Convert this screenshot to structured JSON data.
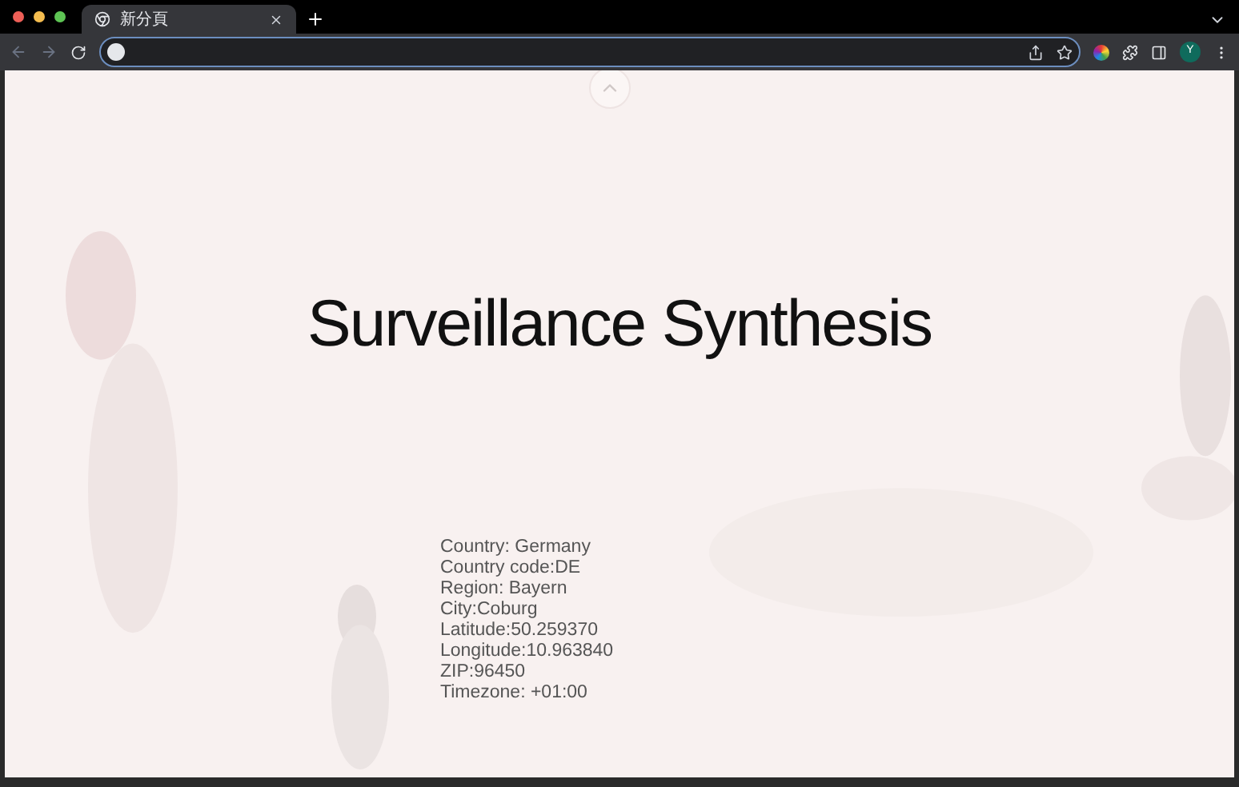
{
  "browser": {
    "tab": {
      "title": "新分頁"
    },
    "profile_initial": "Y"
  },
  "page": {
    "title": "Surveillance Synthesis",
    "info": [
      "Country: Germany",
      "Country code:DE",
      "Region: Bayern",
      "City:Coburg",
      "Latitude:50.259370",
      "Longitude:10.963840",
      "ZIP:96450",
      "Timezone: +01:00"
    ]
  }
}
